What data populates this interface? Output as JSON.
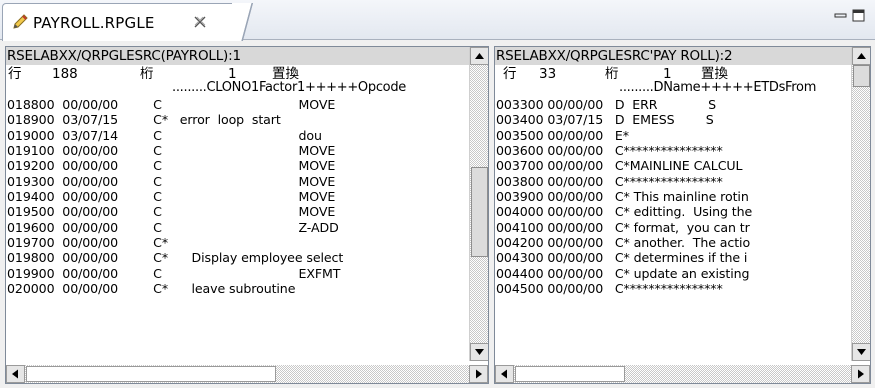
{
  "tab": {
    "title": "PAYROLL.RPGLE"
  },
  "icons": {
    "tab": "pencil-edit-icon",
    "close": "close-icon",
    "minimize": "minimize-icon",
    "maximize": "maximize-icon"
  },
  "left": {
    "title": "RSELABXX/QRPGLESRC(PAYROLL):1",
    "line_label": "行",
    "line_value": "188",
    "column_label": "桁",
    "column_value": "1",
    "mode": "置換",
    "ruler": ".........CLONO1Factor1+++++Opcode",
    "code": "018800  00/00/00         C                                   MOVE\n018900  03/07/15         C*   error  loop  start\n019000  03/07/14         C                                   dou\n019100  00/00/00         C                                   MOVE\n019200  00/00/00         C                                   MOVE\n019300  00/00/00         C                                   MOVE\n019400  00/00/00         C                                   MOVE\n019500  00/00/00         C                                   MOVE\n019600  00/00/00         C                                   Z-ADD\n019700  00/00/00         C*\n019800  00/00/00         C*      Display employee select\n019900  00/00/00         C                                   EXFMT\n020000  00/00/00         C*      leave subroutine"
  },
  "right": {
    "title": "RSELABXX/QRPGLESRC'PAY ROLL):2",
    "line_label": "行",
    "line_value": "33",
    "column_label": "桁",
    "column_value": "1",
    "mode": "置換",
    "ruler": ".........DName+++++ETDsFrom",
    "code": "003300 00/00/00   D  ERR             S\n003400 03/07/15   D  EMESS        S\n003500 00/00/00   E*\n003600 00/00/00   C****************\n003700 00/00/00   C*MAINLINE CALCUL\n003800 00/00/00   C****************\n003900 00/00/00   C* This mainline rotin\n004000 00/00/00   C* editting.  Using the\n004100 00/00/00   C* format,  you can tr\n004200 00/00/00   C* another.  The actio\n004300 00/00/00   C* determines if the i\n004400 00/00/00   C* update an existing\n004500 00/00/00   C****************"
  }
}
